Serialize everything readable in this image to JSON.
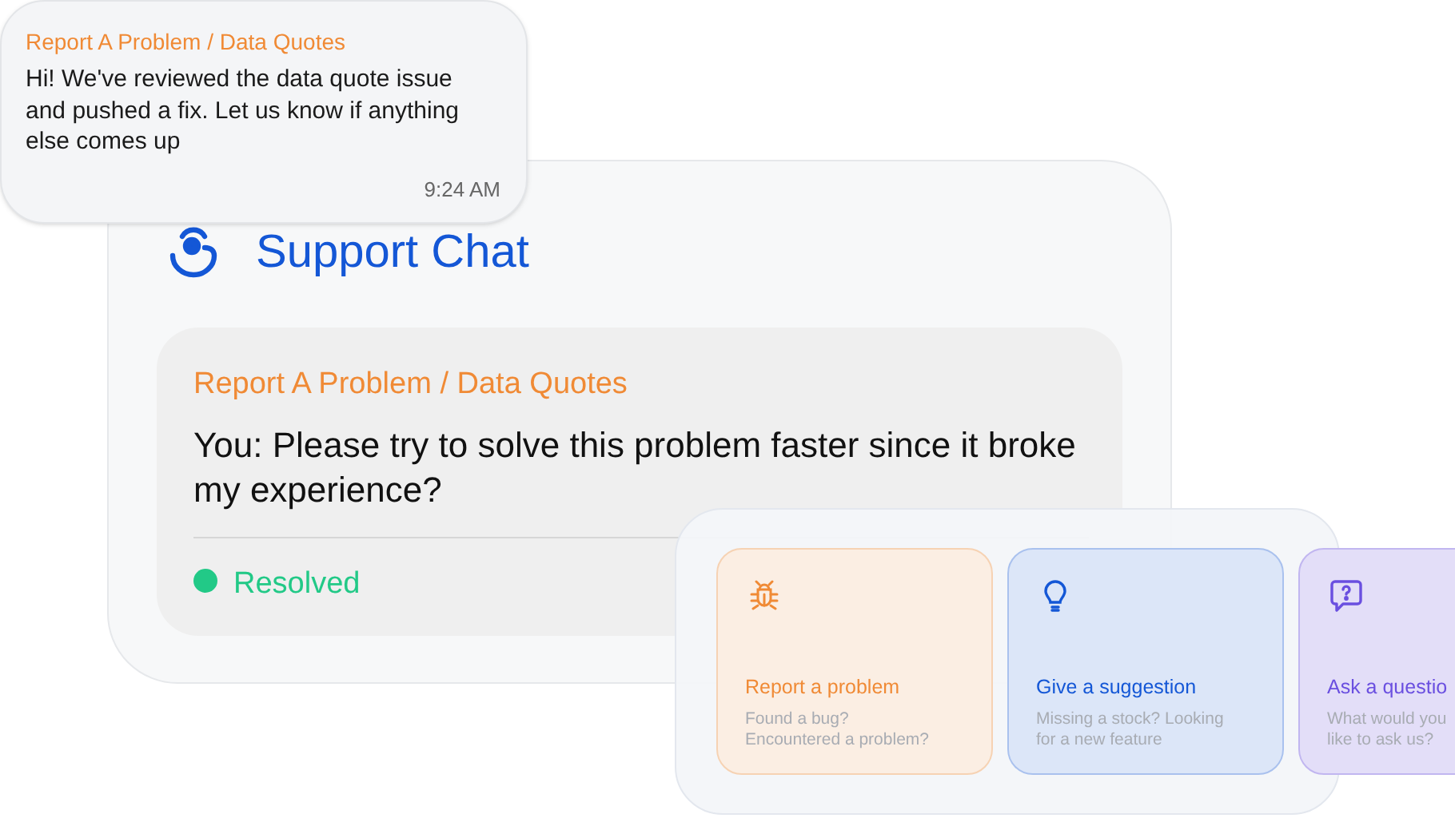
{
  "bubble": {
    "topic": "Report A Problem / Data Quotes",
    "message": "Hi! We've reviewed the data quote issue and pushed a fix. Let us know if anything else comes up",
    "time": "9:24 AM"
  },
  "chat": {
    "title": "Support Chat",
    "ticket": {
      "topic": "Report A Problem / Data Quotes",
      "message": "You: Please try to solve this problem faster since it broke my experience?",
      "status": {
        "label": "Resolved",
        "color": "#22c987"
      }
    }
  },
  "options": [
    {
      "kind": "bug",
      "title": "Report a problem",
      "description": [
        "Found a bug?",
        "Encountered a problem?"
      ],
      "color": "#f08a35"
    },
    {
      "kind": "bulb",
      "title": "Give a suggestion",
      "description": [
        "Missing a stock? Looking",
        "for a new feature"
      ],
      "color": "#1457d6"
    },
    {
      "kind": "question",
      "title": "Ask a questio",
      "description": [
        "What would you",
        "like to ask us?"
      ],
      "color": "#6a4fe0"
    }
  ]
}
